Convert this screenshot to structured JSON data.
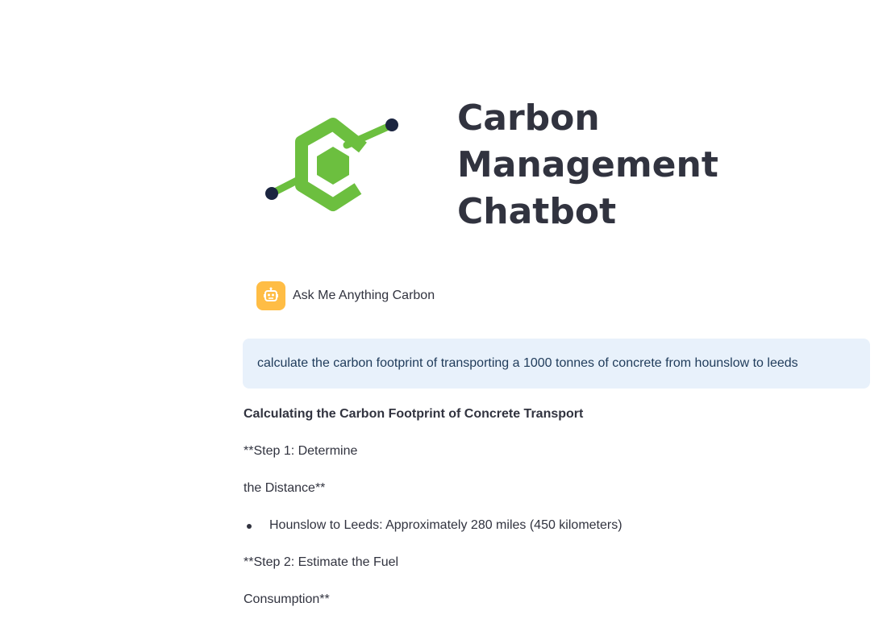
{
  "header": {
    "title_lines": [
      "Carbon",
      "Management",
      "Chatbot"
    ],
    "logo_icon": "carbon-hexagon-logo-icon",
    "logo_colors": {
      "green": "#6cbf3f",
      "node": "#1b2540"
    }
  },
  "assistant": {
    "avatar_icon": "robot-icon",
    "avatar_color": "#ffbd45",
    "greeting": "Ask Me Anything Carbon"
  },
  "user_message": {
    "text": "calculate the carbon footprint of transporting a 1000 tonnes of concrete from hounslow to leeds",
    "background": "#e8f1fb"
  },
  "response": {
    "heading": "Calculating the Carbon Footprint of Concrete Transport",
    "step1_line1": "**Step 1: Determine",
    "step1_line2": "the Distance**",
    "bullet1": "Hounslow to Leeds: Approximately 280 miles (450 kilometers)",
    "step2_line1": "**Step 2: Estimate the Fuel",
    "step2_line2": "Consumption**"
  }
}
